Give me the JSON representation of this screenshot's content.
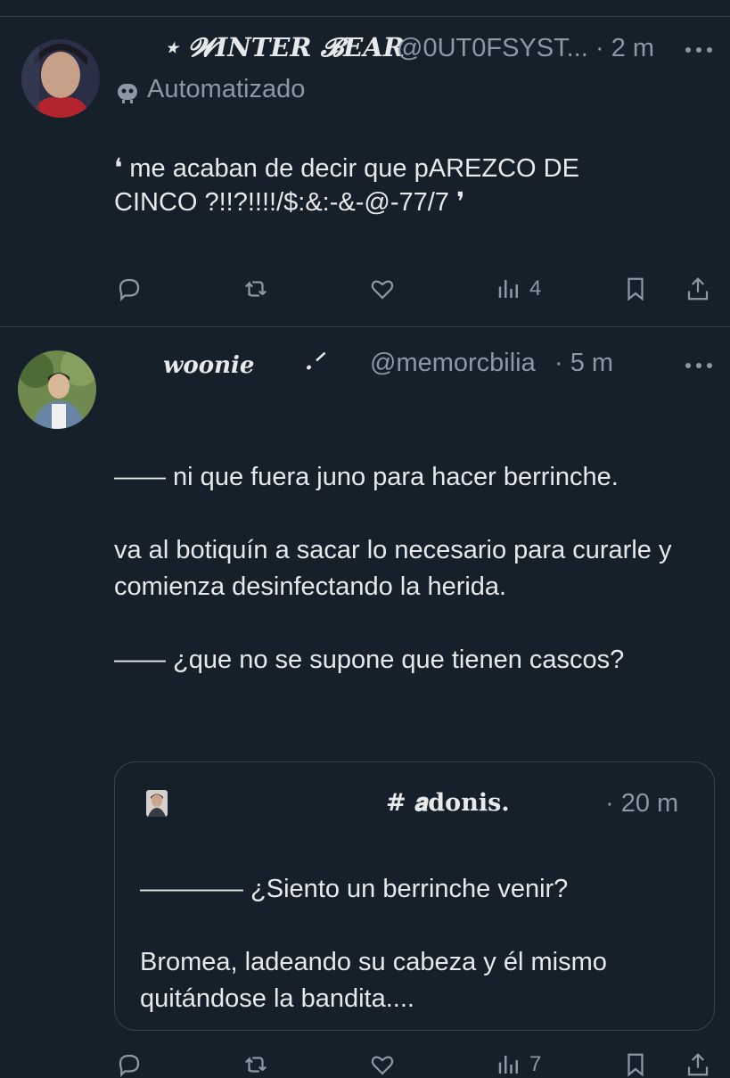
{
  "tweets": [
    {
      "display_name": "⋆ 𝓦INTER 𝓑EAR",
      "handle": "@0UT0FSYST...",
      "time": "· 2 m",
      "automated_label": "Automatizado",
      "text": "❛ me acaban de decir que pAREZCO DE CINCO ?!!?!!!!/$:&:-&-@-77/7 ❜",
      "actions": {
        "views": "4"
      }
    },
    {
      "display_name": "woonie",
      "name_decoration": ".ᐟ",
      "handle": "@memorcbilia",
      "time": "· 5 m",
      "text": "—— ni que fuera juno para hacer berrinche.\n\nva al botiquín a sacar lo necesario para curarle y comienza desinfectando la herida.\n\n—— ¿que no se supone que tienen cascos?",
      "quote": {
        "display_name": "# 𝒂donis.",
        "time": "· 20 m",
        "text": "———— ¿Siento un berrinche venir?\n\nBromea, ladeando su cabeza y él mismo quitándose la bandita...."
      },
      "actions": {
        "views": "7"
      }
    }
  ],
  "icons": {
    "more": "more-icon",
    "reply": "reply-icon",
    "retweet": "retweet-icon",
    "like": "heart-icon",
    "views": "views-icon",
    "bookmark": "bookmark-icon",
    "share": "share-icon",
    "bot": "bot-icon"
  },
  "colors": {
    "background": "#15202b",
    "text": "#e7e9ea",
    "secondary": "#8b98a5",
    "border": "#38444d"
  }
}
